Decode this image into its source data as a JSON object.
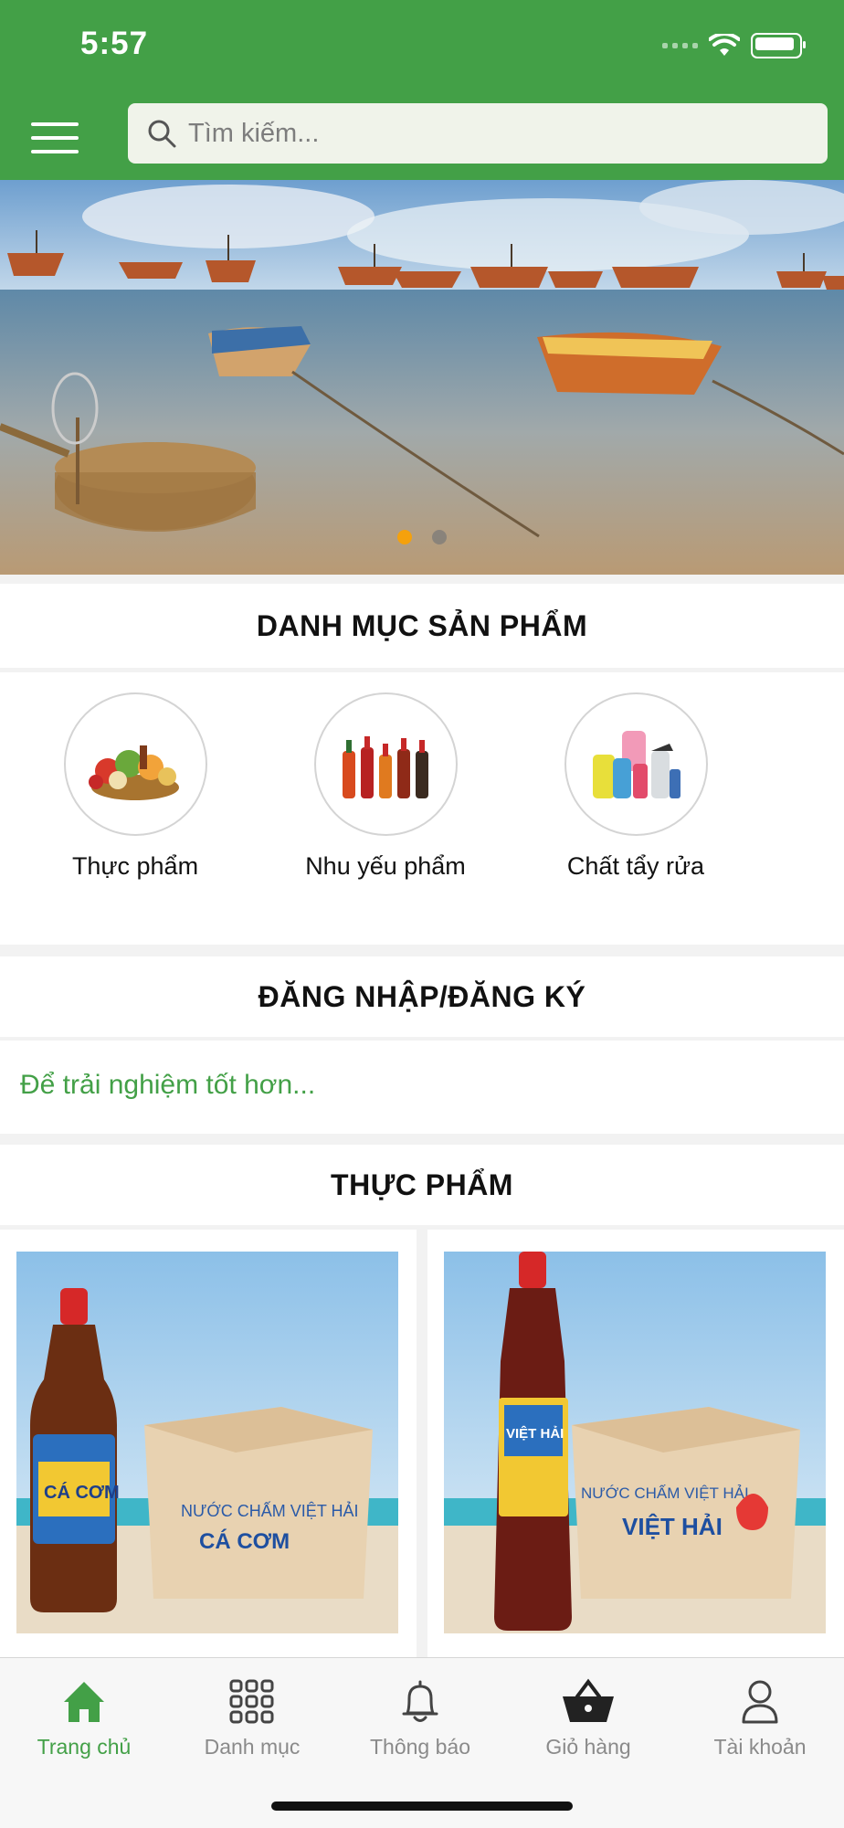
{
  "status_bar": {
    "time": "5:57"
  },
  "header": {
    "search_placeholder": "Tìm kiếm...",
    "accent": "#43a047"
  },
  "banner": {
    "page_count": 2,
    "active_page": 1
  },
  "categories": {
    "title": "DANH MỤC SẢN PHẨM",
    "items": [
      {
        "label": "Thực phẩm"
      },
      {
        "label": "Nhu yếu phẩm"
      },
      {
        "label": "Chất tẩy rửa"
      }
    ]
  },
  "login": {
    "title": "ĐĂNG NHẬP/ĐĂNG KÝ",
    "hint": "Để trải nghiệm tốt hơn..."
  },
  "food": {
    "title": "THỰC PHẨM",
    "products": [
      {
        "brand_text": "CÁ CƠM",
        "box_text": "NƯỚC CHẤM VIỆT HẢI",
        "box_sub": "CÁ CƠM"
      },
      {
        "brand_text": "VIỆT HẢI",
        "box_text": "NƯỚC CHẤM VIỆT HẢI",
        "box_sub": "VIỆT HẢI"
      }
    ]
  },
  "tab_bar": {
    "items": [
      {
        "label": "Trang chủ",
        "icon": "home-icon",
        "active": true
      },
      {
        "label": "Danh mục",
        "icon": "grid-icon",
        "active": false
      },
      {
        "label": "Thông báo",
        "icon": "bell-icon",
        "active": false
      },
      {
        "label": "Giỏ hàng",
        "icon": "basket-icon",
        "active": false
      },
      {
        "label": "Tài khoản",
        "icon": "user-icon",
        "active": false
      }
    ]
  }
}
